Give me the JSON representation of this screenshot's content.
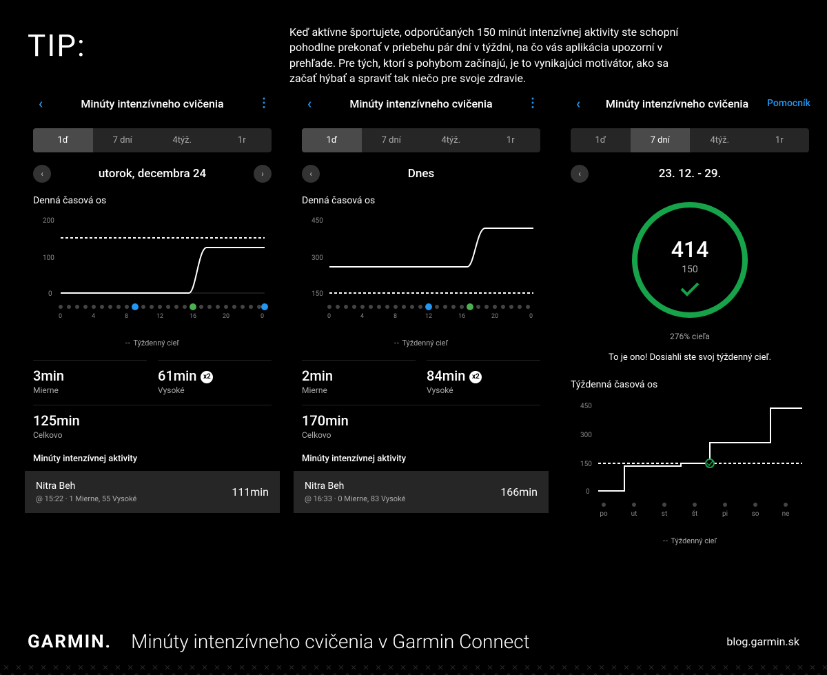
{
  "tip": {
    "title": "TIP:",
    "body": "Keď aktívne športujete, odporúčaných 150 minút intenzívnej aktivity ste schopní pohodlne prekonať v priebehu pár dní v týždni, na čo vás aplikácia upozorní v prehľade. Pre tých, ktorí s pohybom začínajú, je to vynikajúci motivátor, ako sa začať hýbať a spraviť tak niečo pre svoje zdravie."
  },
  "common": {
    "title": "Minúty intenzívneho cvičenia",
    "help": "Pomocník",
    "range_tabs": [
      "1ď",
      "7 dní",
      "4týž.",
      "1r"
    ],
    "timeline_label": "Denná časová os",
    "legend": "Týždenný cieľ",
    "moderate_label": "Mierne",
    "vigorous_label": "Vysoké",
    "total_label": "Celkovo",
    "activity_header": "Minúty intenzívnej aktivity",
    "week_timeline_label": "Týždenná časová os"
  },
  "panel1": {
    "active_tab": 0,
    "date": "utorok, decembra 24",
    "moderate": "3min",
    "vigorous": "61min",
    "x2": "x2",
    "total": "125min",
    "activity": {
      "name": "Nitra Beh",
      "meta": "@ 15:22 · 1 Mierne, 55 Vysoké",
      "value": "111min"
    }
  },
  "panel2": {
    "active_tab": 0,
    "date": "Dnes",
    "moderate": "2min",
    "vigorous": "84min",
    "x2": "x2",
    "total": "170min",
    "activity": {
      "name": "Nitra Beh",
      "meta": "@ 16:33 · 0 Mierne, 83 Vysoké",
      "value": "166min"
    }
  },
  "panel3": {
    "active_tab": 1,
    "date": "23. 12. - 29.",
    "ring_value": "414",
    "ring_goal": "150",
    "pct": "276% cieľa",
    "achieved": "To je ono! Dosiahli ste svoj týždenný cieľ."
  },
  "chart_data": [
    {
      "type": "line",
      "panel": 1,
      "title": "Denná časová os",
      "x_hours": [
        0,
        4,
        8,
        12,
        16,
        20,
        0
      ],
      "y_ticks": [
        0,
        100,
        200
      ],
      "goal_line": 150,
      "series": [
        {
          "name": "cumulative",
          "values": [
            [
              0,
              0
            ],
            [
              14,
              0
            ],
            [
              16,
              125
            ],
            [
              24,
              125
            ]
          ]
        }
      ],
      "event_markers": [
        {
          "hour": 9,
          "type": "blue"
        },
        {
          "hour": 16,
          "type": "green-run"
        },
        {
          "hour": 24,
          "type": "blue-sleep"
        }
      ]
    },
    {
      "type": "line",
      "panel": 2,
      "title": "Denná časová os",
      "x_hours": [
        0,
        4,
        8,
        12,
        16,
        20,
        0
      ],
      "y_ticks": [
        150,
        300,
        450
      ],
      "goal_line": 150,
      "series": [
        {
          "name": "cumulative",
          "values": [
            [
              0,
              260
            ],
            [
              16,
              260
            ],
            [
              17,
              420
            ],
            [
              24,
              420
            ]
          ]
        }
      ],
      "event_markers": [
        {
          "hour": 12,
          "type": "blue"
        },
        {
          "hour": 17,
          "type": "green-run"
        }
      ]
    },
    {
      "type": "step",
      "panel": 3,
      "title": "Týždenná časová os",
      "categories": [
        "po",
        "ut",
        "st",
        "št",
        "pi",
        "so",
        "ne"
      ],
      "y_ticks": [
        0,
        150,
        300,
        450
      ],
      "goal_line": 150,
      "series": [
        {
          "name": "cumulative",
          "values": [
            0,
            0,
            125,
            125,
            140,
            250,
            250,
            430
          ]
        }
      ],
      "goal_reached_marker": {
        "category": "pi"
      }
    }
  ],
  "footer": {
    "brand": "GARMIN.",
    "title": "Minúty intenzívneho cvičenia v Garmin Connect",
    "blog": "blog.garmin.sk"
  }
}
